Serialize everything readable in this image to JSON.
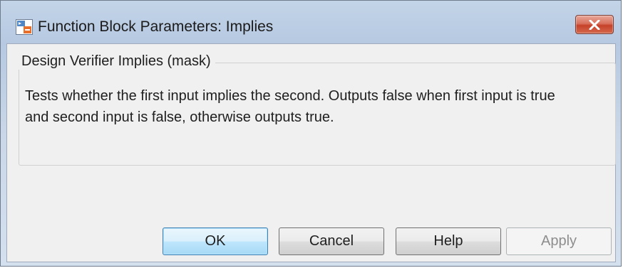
{
  "window": {
    "title": "Function Block Parameters: Implies"
  },
  "group": {
    "legend": "Design Verifier Implies (mask)",
    "description": "Tests whether the first input implies the second.  Outputs false when first input is true and second input is false, otherwise outputs true."
  },
  "buttons": {
    "ok": "OK",
    "cancel": "Cancel",
    "help": "Help",
    "apply": "Apply"
  },
  "icons": {
    "app": "simulink-block-icon",
    "close": "close-icon"
  },
  "colors": {
    "close_button": "#c6422a",
    "default_button_border": "#3c7fb1",
    "dialog_background": "#f0f0f0"
  }
}
